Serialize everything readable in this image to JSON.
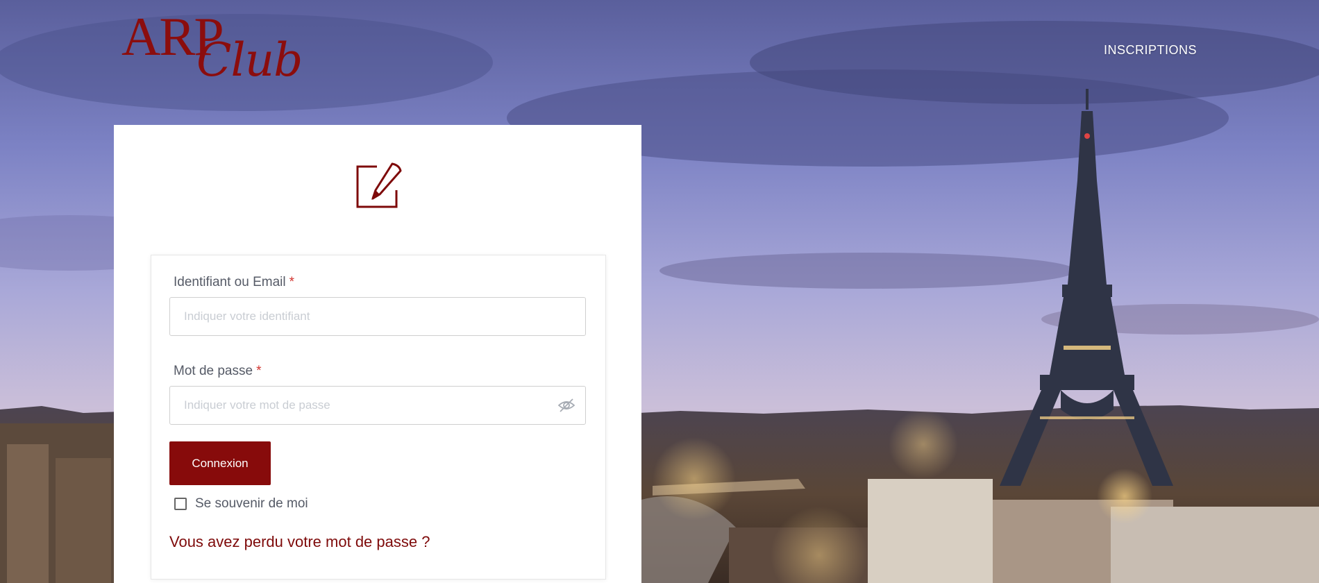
{
  "brand": {
    "logo_top": "ARP",
    "logo_bottom": "Club",
    "color": "#8b0d0d"
  },
  "header": {
    "nav_link": "INSCRIPTIONS"
  },
  "form": {
    "icon": "edit-square-icon",
    "username": {
      "label": "Identifiant ou Email",
      "required_mark": "*",
      "placeholder": "Indiquer votre identifiant",
      "value": ""
    },
    "password": {
      "label": "Mot de passe",
      "required_mark": "*",
      "placeholder": "Indiquer votre mot de passe",
      "value": "",
      "toggle_icon": "eye-slash-icon"
    },
    "submit_label": "Connexion",
    "remember_label": "Se souvenir de moi",
    "remember_checked": false,
    "forgot_link": "Vous avez perdu votre mot de passe ?"
  },
  "colors": {
    "accent": "#870b0b",
    "required": "#d2332e",
    "label": "#555a66"
  }
}
